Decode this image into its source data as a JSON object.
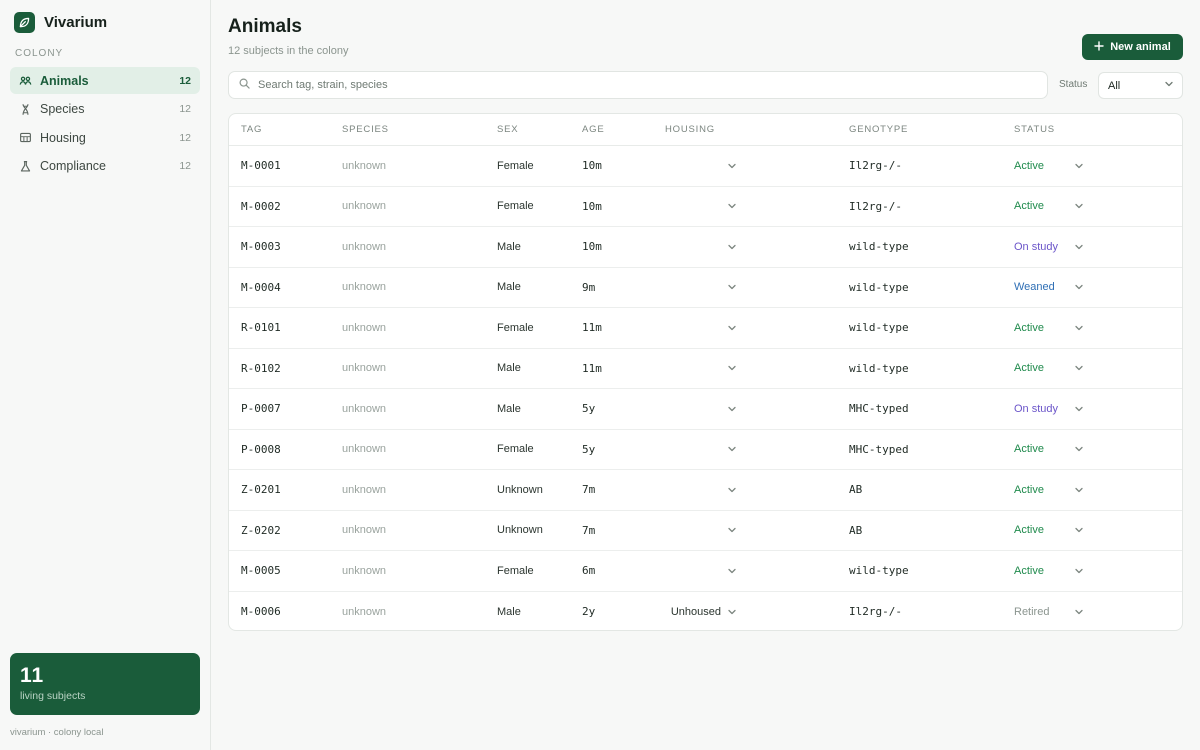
{
  "app": {
    "name": "Vivarium"
  },
  "sidebar": {
    "section_label": "COLONY",
    "items": [
      {
        "label": "Animals",
        "count": "12",
        "icon": "paw-icon",
        "active": true
      },
      {
        "label": "Species",
        "count": "12",
        "icon": "dna-icon",
        "active": false
      },
      {
        "label": "Housing",
        "count": "12",
        "icon": "cage-icon",
        "active": false
      },
      {
        "label": "Compliance",
        "count": "12",
        "icon": "flask-icon",
        "active": false
      }
    ],
    "living": {
      "count": "11",
      "label": "living subjects"
    },
    "footer": "vivarium · colony local"
  },
  "header": {
    "title": "Animals",
    "subtitle": "12 subjects in the colony",
    "new_button": "New animal"
  },
  "filters": {
    "search_placeholder": "Search tag, strain, species",
    "status_label": "Status",
    "status_value": "All"
  },
  "table": {
    "columns": [
      "TAG",
      "SPECIES",
      "SEX",
      "AGE",
      "HOUSING",
      "GENOTYPE",
      "STATUS"
    ],
    "rows": [
      {
        "tag": "M-0001",
        "species": "unknown",
        "sex": "Female",
        "age": "10m",
        "housing": "",
        "genotype": "Il2rg-/-",
        "status": "Active"
      },
      {
        "tag": "M-0002",
        "species": "unknown",
        "sex": "Female",
        "age": "10m",
        "housing": "",
        "genotype": "Il2rg-/-",
        "status": "Active"
      },
      {
        "tag": "M-0003",
        "species": "unknown",
        "sex": "Male",
        "age": "10m",
        "housing": "",
        "genotype": "wild-type",
        "status": "On study"
      },
      {
        "tag": "M-0004",
        "species": "unknown",
        "sex": "Male",
        "age": "9m",
        "housing": "",
        "genotype": "wild-type",
        "status": "Weaned"
      },
      {
        "tag": "R-0101",
        "species": "unknown",
        "sex": "Female",
        "age": "11m",
        "housing": "",
        "genotype": "wild-type",
        "status": "Active"
      },
      {
        "tag": "R-0102",
        "species": "unknown",
        "sex": "Male",
        "age": "11m",
        "housing": "",
        "genotype": "wild-type",
        "status": "Active"
      },
      {
        "tag": "P-0007",
        "species": "unknown",
        "sex": "Male",
        "age": "5y",
        "housing": "",
        "genotype": "MHC-typed",
        "status": "On study"
      },
      {
        "tag": "P-0008",
        "species": "unknown",
        "sex": "Female",
        "age": "5y",
        "housing": "",
        "genotype": "MHC-typed",
        "status": "Active"
      },
      {
        "tag": "Z-0201",
        "species": "unknown",
        "sex": "Unknown",
        "age": "7m",
        "housing": "",
        "genotype": "AB",
        "status": "Active"
      },
      {
        "tag": "Z-0202",
        "species": "unknown",
        "sex": "Unknown",
        "age": "7m",
        "housing": "",
        "genotype": "AB",
        "status": "Active"
      },
      {
        "tag": "M-0005",
        "species": "unknown",
        "sex": "Female",
        "age": "6m",
        "housing": "",
        "genotype": "wild-type",
        "status": "Active"
      },
      {
        "tag": "M-0006",
        "species": "unknown",
        "sex": "Male",
        "age": "2y",
        "housing": "Unhoused",
        "genotype": "Il2rg-/-",
        "status": "Retired"
      }
    ]
  },
  "colors": {
    "brand": "#1a5c3a",
    "status_active": "#1f8a4c",
    "status_on_study": "#6b55c9",
    "status_weaned": "#2f6fb5",
    "status_retired": "#8b958f"
  }
}
